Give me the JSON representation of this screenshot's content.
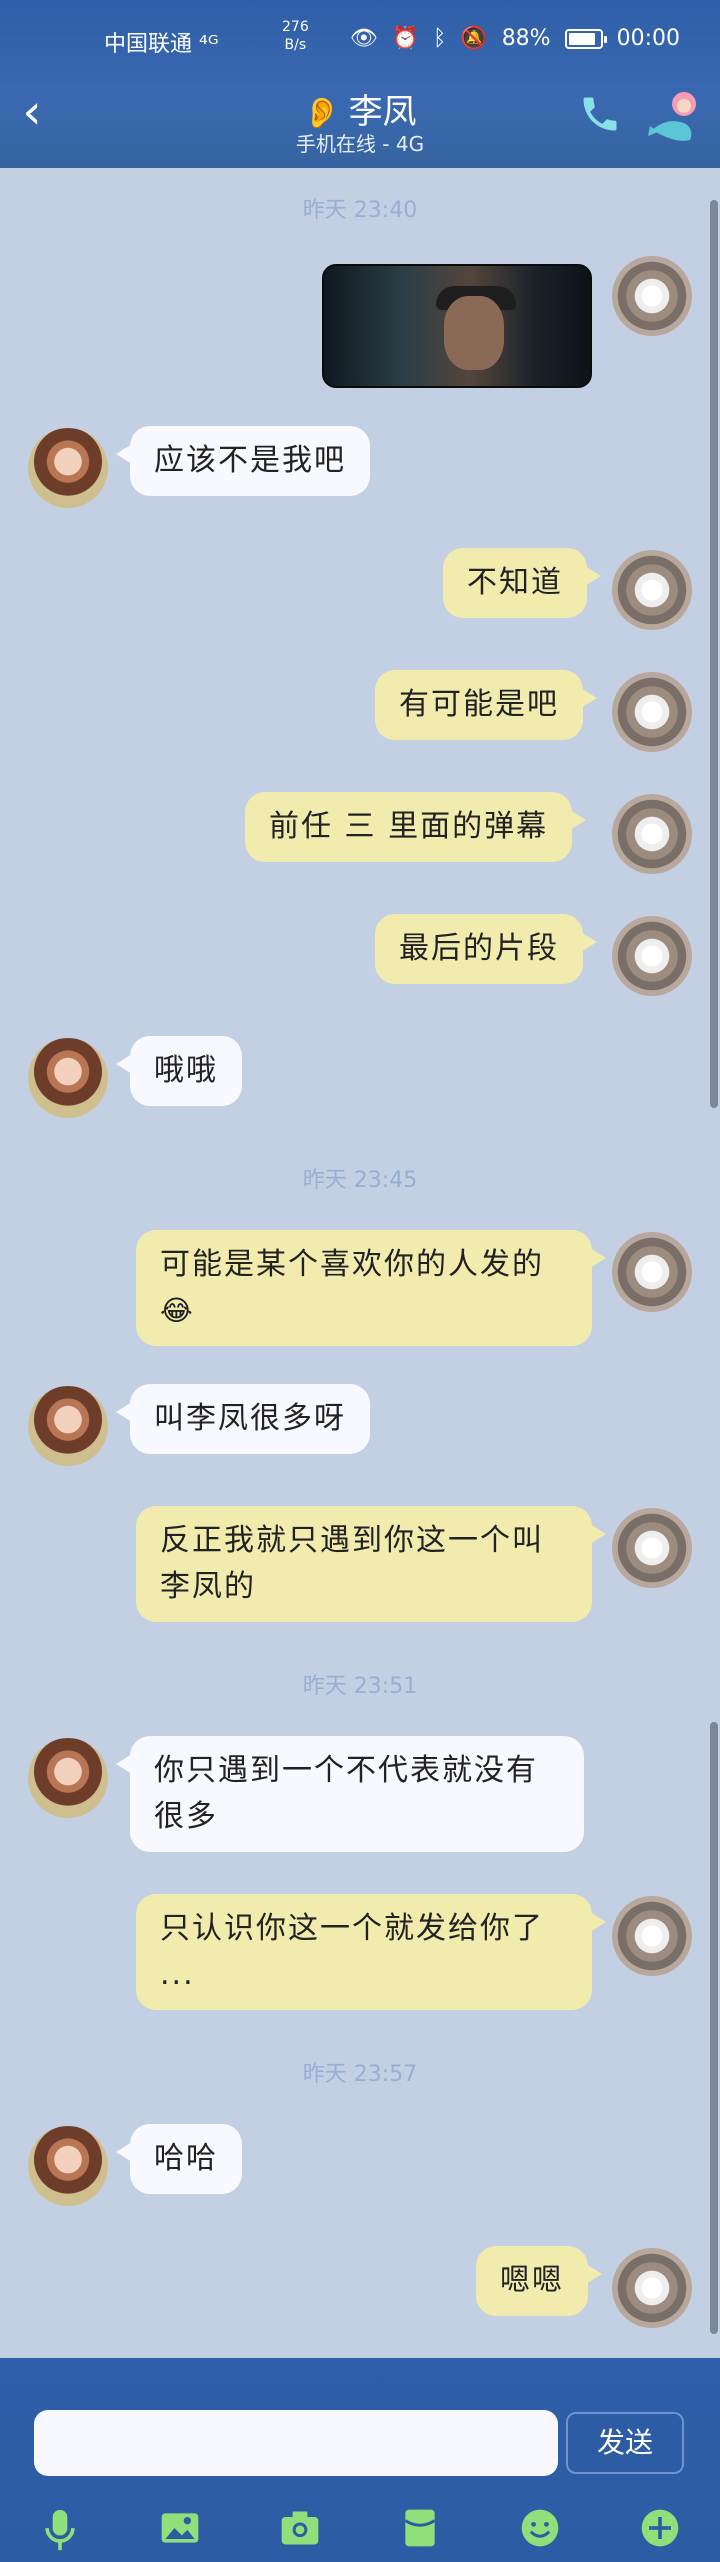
{
  "status_bar": {
    "carrier": "中国联通 ⁴ᴳ",
    "speed_value": "276",
    "speed_unit": "B/s",
    "battery": "88%",
    "time": "00:00",
    "battery_level": 0.88
  },
  "header": {
    "back_icon": "chevron-left-icon",
    "contact_name": "李凤",
    "contact_status": "手机在线 - 4G",
    "call_icon": "phone-icon"
  },
  "messages": {
    "t1": "昨天 23:40",
    "m2": "应该不是我吧",
    "m3": "不知道",
    "m4": "有可能是吧",
    "m5": "前任 三 里面的弹幕",
    "m6": "最后的片段",
    "m7": "哦哦",
    "t2": "昨天 23:45",
    "m8": "可能是某个喜欢你的人发的",
    "m9": "叫李凤很多呀",
    "m10a": "反正我就只遇到你这一个叫",
    "m10b": "李凤的",
    "t3": "昨天 23:51",
    "m11a": "你只遇到一个不代表就没有",
    "m11b": "很多",
    "m12a": "只认识你这一个就发给你了",
    "m12b": "...",
    "t4": "昨天 23:57",
    "m13": "哈哈",
    "m14": "嗯嗯"
  },
  "composer": {
    "input_value": "",
    "send_label": "发送"
  },
  "colors": {
    "header_blue": "#2f5fa8",
    "chat_bg": "#c3cfe3",
    "my_bubble": "#f1ecae",
    "her_bubble": "#f7f9fe",
    "toolbar_green": "#8fe07a"
  }
}
